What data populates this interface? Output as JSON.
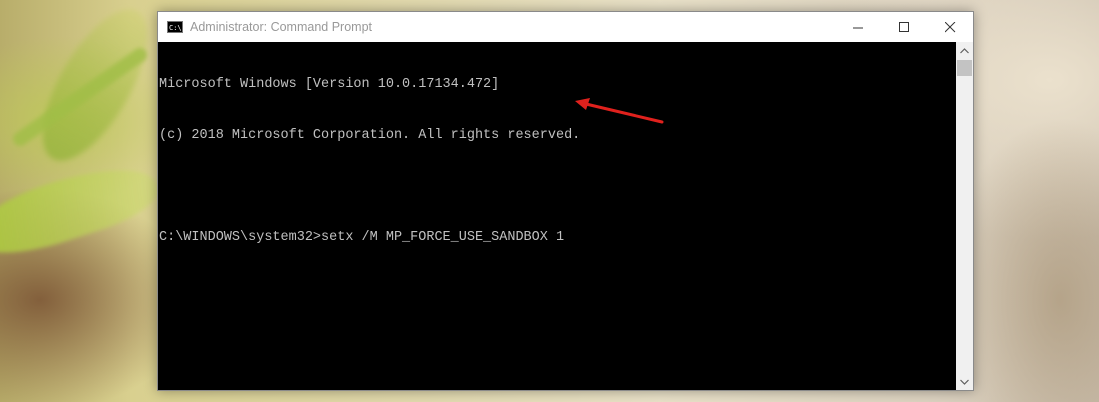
{
  "window": {
    "title": "Administrator: Command Prompt",
    "icon": "cmd-icon",
    "controls": [
      "minimize-icon",
      "maximize-icon",
      "close-icon"
    ]
  },
  "console": {
    "lines": [
      "Microsoft Windows [Version 10.0.17134.472]",
      "(c) 2018 Microsoft Corporation. All rights reserved.",
      "",
      "C:\\WINDOWS\\system32>setx /M MP_FORCE_USE_SANDBOX 1"
    ]
  },
  "annotation": {
    "type": "arrow",
    "color": "#e0211d",
    "points_to": "setx command"
  },
  "colors": {
    "console_bg": "#000000",
    "console_text": "#c0c0c0",
    "titlebar_bg": "#ffffff"
  }
}
